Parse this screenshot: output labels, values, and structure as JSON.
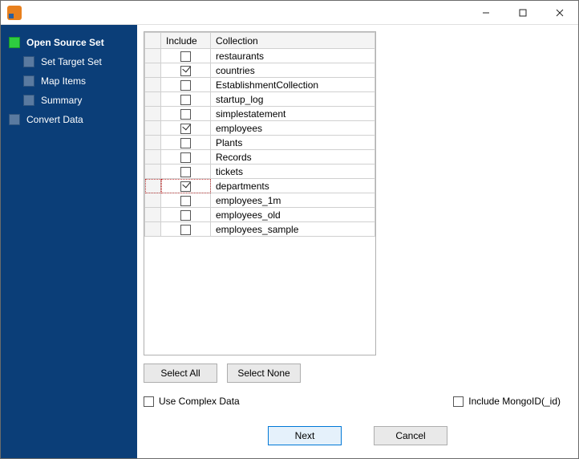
{
  "window": {
    "title": ""
  },
  "nav": {
    "items": [
      {
        "label": "Open Source Set",
        "active": true,
        "level": 0
      },
      {
        "label": "Set Target Set",
        "active": false,
        "level": 1
      },
      {
        "label": "Map Items",
        "active": false,
        "level": 1
      },
      {
        "label": "Summary",
        "active": false,
        "level": 1
      },
      {
        "label": "Convert Data",
        "active": false,
        "level": 0
      }
    ]
  },
  "table": {
    "headers": {
      "include": "Include",
      "collection": "Collection"
    },
    "rows": [
      {
        "include": false,
        "collection": "restaurants",
        "selected": false
      },
      {
        "include": true,
        "collection": "countries",
        "selected": false
      },
      {
        "include": false,
        "collection": "EstablishmentCollection",
        "selected": false
      },
      {
        "include": false,
        "collection": "startup_log",
        "selected": false
      },
      {
        "include": false,
        "collection": "simplestatement",
        "selected": false
      },
      {
        "include": true,
        "collection": "employees",
        "selected": false
      },
      {
        "include": false,
        "collection": "Plants",
        "selected": false
      },
      {
        "include": false,
        "collection": "Records",
        "selected": false
      },
      {
        "include": false,
        "collection": "tickets",
        "selected": false
      },
      {
        "include": true,
        "collection": "departments",
        "selected": true
      },
      {
        "include": false,
        "collection": "employees_1m",
        "selected": false
      },
      {
        "include": false,
        "collection": "employees_old",
        "selected": false
      },
      {
        "include": false,
        "collection": "employees_sample",
        "selected": false
      }
    ]
  },
  "buttons": {
    "select_all": "Select All",
    "select_none": "Select None",
    "next": "Next",
    "cancel": "Cancel"
  },
  "options": {
    "use_complex_data": {
      "label": "Use Complex Data",
      "checked": false
    },
    "include_mongoid": {
      "label": "Include MongoID(_id)",
      "checked": false
    }
  }
}
